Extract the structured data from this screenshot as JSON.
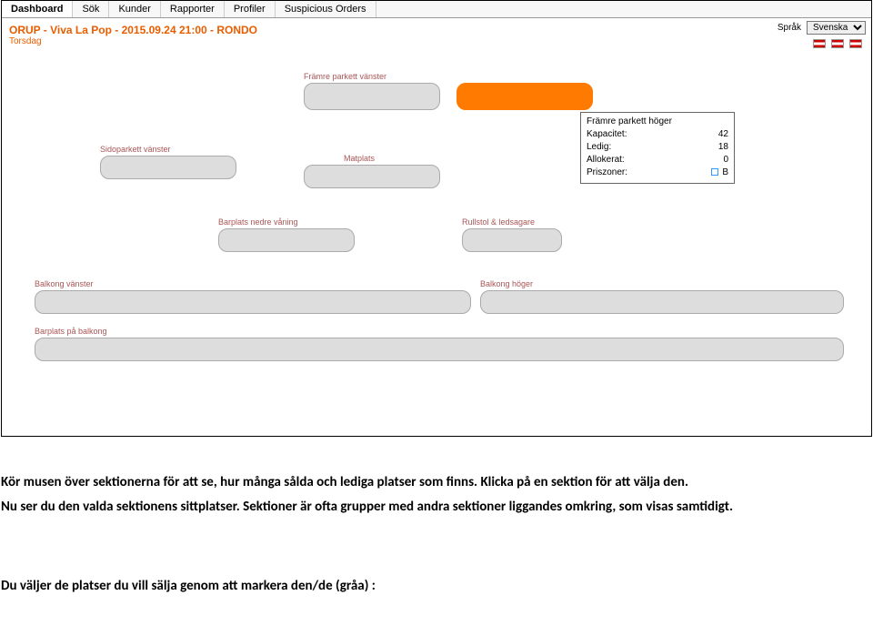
{
  "nav": {
    "items": [
      "Dashboard",
      "Sök",
      "Kunder",
      "Rapporter",
      "Profiler",
      "Suspicious Orders"
    ],
    "active_index": 0
  },
  "lang": {
    "label": "Språk",
    "selected": "Svenska"
  },
  "event": {
    "title": "ORUP - Viva La Pop - 2015.09.24 21:00 - RONDO",
    "day": "Torsdag"
  },
  "sections": {
    "framre_parkett_vanster": {
      "label": "Främre parkett vänster"
    },
    "framre_parkett_hoger": {
      "label": "Främre parkett höger"
    },
    "sidoparkett_vanster": {
      "label": "Sidoparkett vänster"
    },
    "matplats": {
      "label": "Matplats"
    },
    "barplats_nedre_vaning": {
      "label": "Barplats nedre våning"
    },
    "rullstol_ledsagare": {
      "label": "Rullstol & ledsagare"
    },
    "balkong_vanster": {
      "label": "Balkong vänster"
    },
    "balkong_hoger": {
      "label": "Balkong höger"
    },
    "barplats_pa_balkong": {
      "label": "Barplats på balkong"
    }
  },
  "tooltip": {
    "title": "Främre parkett höger",
    "rows": {
      "kapacitet": {
        "label": "Kapacitet:",
        "value": "42"
      },
      "ledig": {
        "label": "Ledig:",
        "value": "18"
      },
      "allokerat": {
        "label": "Allokerat:",
        "value": "0"
      },
      "priszoner": {
        "label": "Priszoner:",
        "value": "B"
      }
    }
  },
  "instructions": {
    "p1": "Kör musen över sektionerna för att se, hur många sålda och lediga platser som finns. Klicka på en sektion för att välja den.",
    "p2": "Nu ser du den valda sektionens sittplatser. Sektioner är ofta grupper med andra sektioner liggandes omkring, som visas samtidigt.",
    "p3": "Du väljer de platser du vill sälja genom att markera den/de (gråa) :"
  }
}
